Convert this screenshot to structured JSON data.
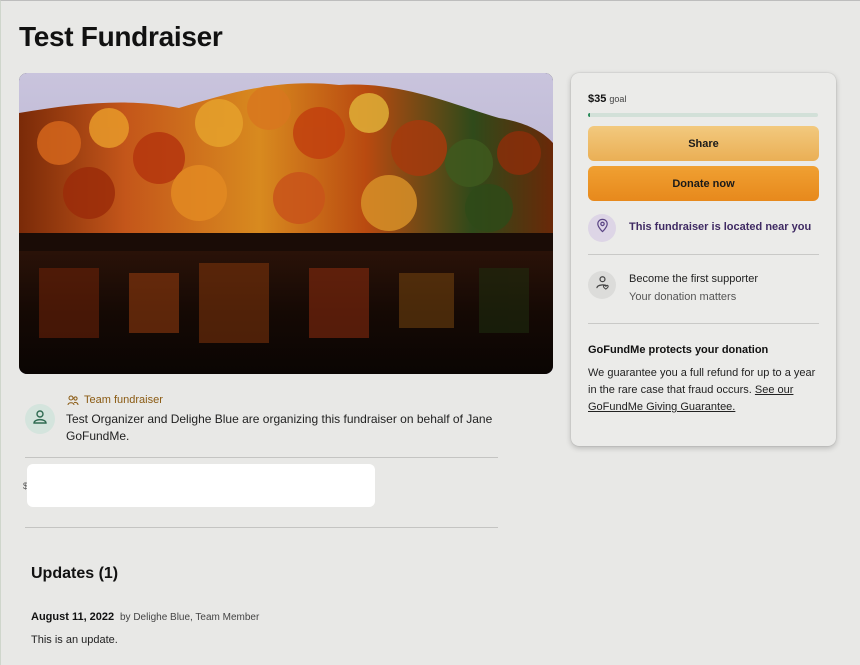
{
  "page": {
    "title": "Test Fundraiser"
  },
  "organizer": {
    "tag": "Team fundraiser",
    "description": "Test Organizer and Delighe Blue are organizing this fundraiser on behalf of Jane GoFundMe."
  },
  "misc": {
    "cut_off_char": "$"
  },
  "updates": {
    "heading": "Updates (1)",
    "items": [
      {
        "date": "August 11, 2022",
        "byline": "by Delighe Blue, Team Member",
        "text": "This is an update."
      }
    ]
  },
  "donation_card": {
    "amount": "$35",
    "goal_label": "goal",
    "progress_fraction": 0.01,
    "share_label": "Share",
    "donate_label": "Donate now",
    "location_text": "This fundraiser is located near you",
    "supporter_title": "Become the first supporter",
    "supporter_subtitle": "Your donation matters",
    "protect_title": "GoFundMe protects your donation",
    "protect_text": "We guarantee you a full refund for up to a year in the rare case that fraud occurs. ",
    "protect_link": "See our GoFundMe Giving Guarantee."
  },
  "colors": {
    "share_button": "#eab45c",
    "donate_button": "#ea8f22",
    "location_text": "#3f2a63",
    "progress_fill": "#2a8a5a"
  }
}
